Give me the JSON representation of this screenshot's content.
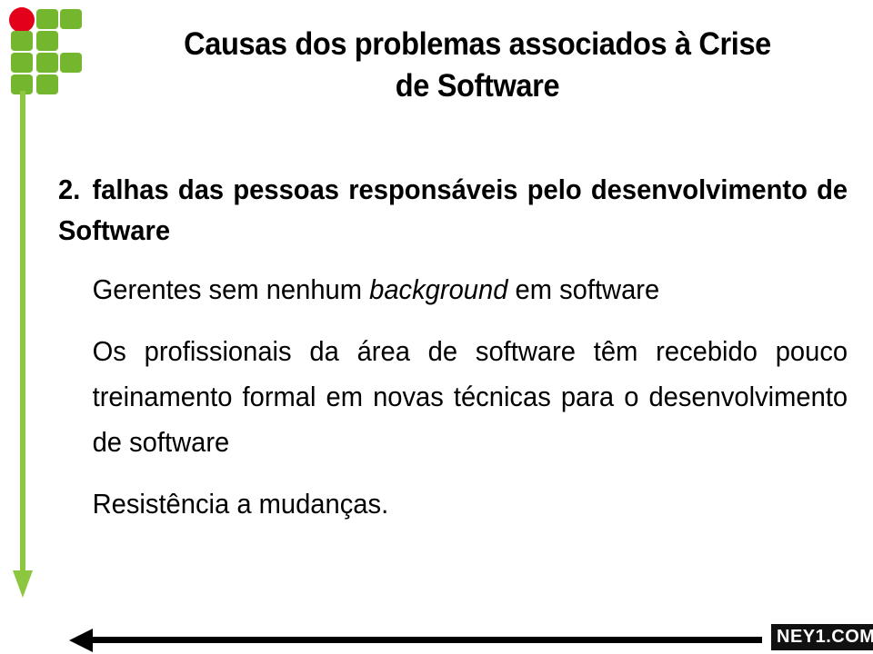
{
  "slide": {
    "title_line1": "Causas dos problemas associados à Crise",
    "title_line2": "de Software",
    "numbered_item": {
      "number": "2.",
      "text": "falhas das pessoas responsáveis pelo desenvolvimento de Software"
    },
    "paragraphs": [
      {
        "before": "Gerentes sem nenhum ",
        "emphasis": "background",
        "after": " em software"
      },
      {
        "before": "Os profissionais da área de software têm recebido pouco treinamento formal em novas técnicas para o desenvolvimento de software",
        "emphasis": "",
        "after": ""
      },
      {
        "before": "Resistência a mudanças.",
        "emphasis": "",
        "after": ""
      }
    ]
  },
  "watermark": {
    "label": "NEY1.COM"
  },
  "colors": {
    "logo_green": "#74b72e",
    "logo_red": "#e2001a",
    "arrow_green": "#8dc63f",
    "arrow_black": "#000000",
    "text": "#000000",
    "background": "#ffffff"
  },
  "icons": {
    "logo": "ifrn-logo-icon",
    "left_arrow_down": "arrow-down-icon",
    "bottom_arrow_left": "arrow-left-icon"
  }
}
